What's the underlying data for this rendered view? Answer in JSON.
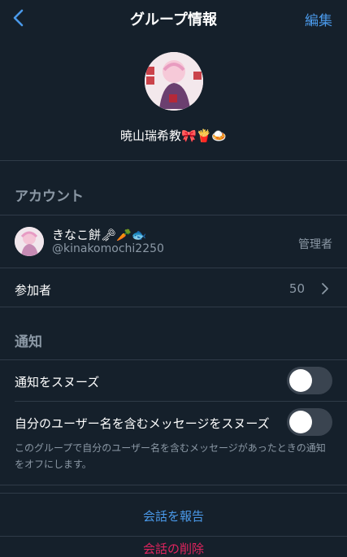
{
  "nav": {
    "title": "グループ情報",
    "edit_label": "編集"
  },
  "group": {
    "name": "暁山瑞希教🎀🍟🍛"
  },
  "account_section": {
    "label": "アカウント"
  },
  "member": {
    "name": "きなこ餅🗝🥕🐟",
    "handle": "@kinakomochi2250",
    "role": "管理者"
  },
  "participants": {
    "label": "参加者",
    "count": "50"
  },
  "notification_section": {
    "label": "通知"
  },
  "notifications": [
    {
      "label": "通知をスヌーズ",
      "on": false
    },
    {
      "label": "自分のユーザー名を含むメッセージをスヌーズ",
      "on": false
    }
  ],
  "note": "このグループで自分のユーザー名を含むメッセージがあったときの通知をオフにします。",
  "actions": {
    "report": "会話を報告",
    "delete": "会話の削除"
  },
  "colors": {
    "background": "#15202b",
    "accent": "#4a99e9",
    "muted": "#8b98a5",
    "divider": "#2f3b48"
  }
}
